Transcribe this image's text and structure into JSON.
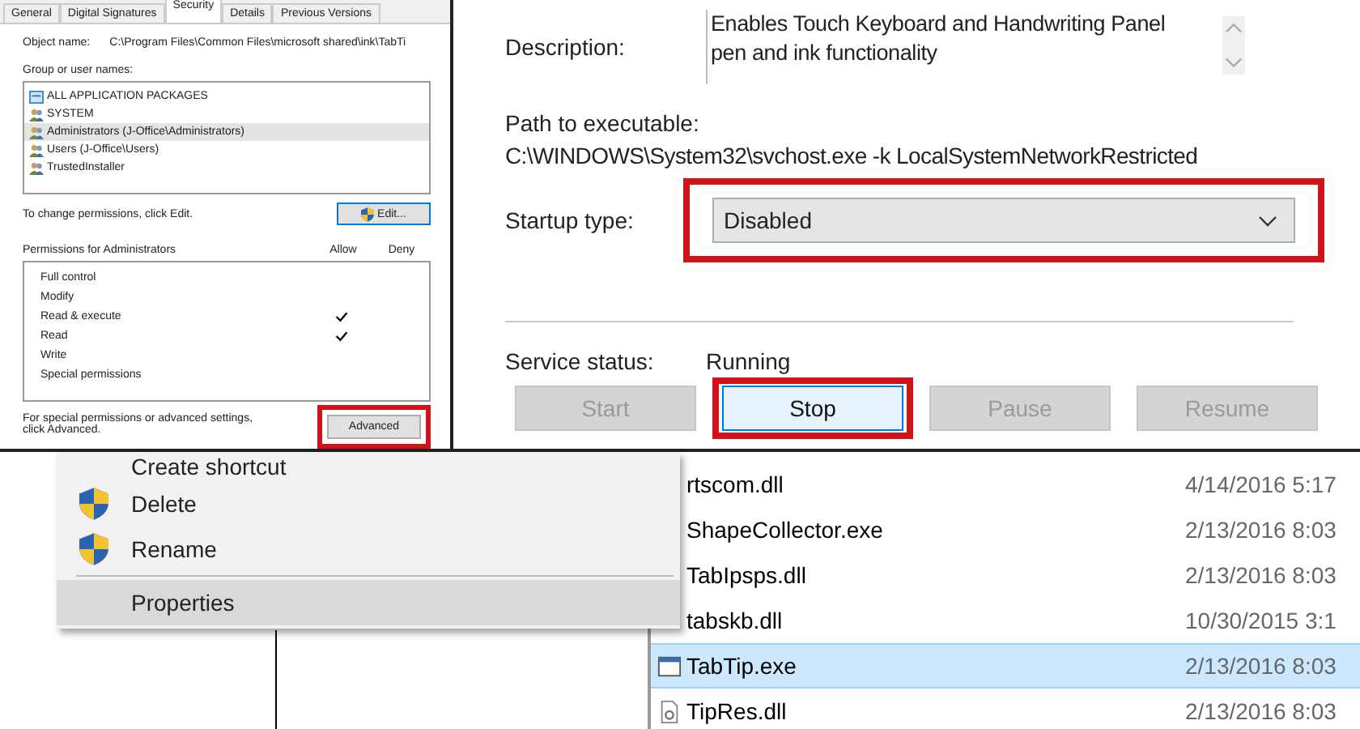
{
  "security": {
    "tabs": [
      {
        "label": "General",
        "selected": false
      },
      {
        "label": "Digital Signatures",
        "selected": false
      },
      {
        "label": "Security",
        "selected": true
      },
      {
        "label": "Details",
        "selected": false
      },
      {
        "label": "Previous Versions",
        "selected": false
      }
    ],
    "object_name_label": "Object name:",
    "object_name": "C:\\Program Files\\Common Files\\microsoft shared\\ink\\TabTi",
    "group_label": "Group or user names:",
    "groups": [
      {
        "name": "ALL APPLICATION PACKAGES",
        "kind": "package",
        "selected": false
      },
      {
        "name": "SYSTEM",
        "kind": "users",
        "selected": false
      },
      {
        "name": "Administrators (J-Office\\Administrators)",
        "kind": "users",
        "selected": true
      },
      {
        "name": "Users (J-Office\\Users)",
        "kind": "users",
        "selected": false
      },
      {
        "name": "TrustedInstaller",
        "kind": "users",
        "selected": false
      }
    ],
    "change_hint": "To change permissions, click Edit.",
    "edit_button": "Edit...",
    "permissions_label": "Permissions for Administrators",
    "allow_heading": "Allow",
    "deny_heading": "Deny",
    "permissions": [
      {
        "name": "Full control",
        "allow": false,
        "deny": false
      },
      {
        "name": "Modify",
        "allow": false,
        "deny": false
      },
      {
        "name": "Read & execute",
        "allow": true,
        "deny": false
      },
      {
        "name": "Read",
        "allow": true,
        "deny": false
      },
      {
        "name": "Write",
        "allow": false,
        "deny": false
      },
      {
        "name": "Special permissions",
        "allow": false,
        "deny": false
      }
    ],
    "advanced_hint": "For special permissions or advanced settings, click Advanced.",
    "advanced_button": "Advanced",
    "advanced_highlighted": true
  },
  "service": {
    "description_label": "Description:",
    "description": "Enables Touch Keyboard and Handwriting Panel pen and ink functionality",
    "path_label": "Path to executable:",
    "path": "C:\\WINDOWS\\System32\\svchost.exe -k LocalSystemNetworkRestricted",
    "startup_label": "Startup type:",
    "startup_value": "Disabled",
    "startup_highlighted": true,
    "status_label": "Service status:",
    "status": "Running",
    "buttons": [
      {
        "label": "Start",
        "disabled": true,
        "highlighted": false
      },
      {
        "label": "Stop",
        "disabled": false,
        "highlighted": true
      },
      {
        "label": "Pause",
        "disabled": true,
        "highlighted": false
      },
      {
        "label": "Resume",
        "disabled": true,
        "highlighted": false
      }
    ]
  },
  "context_menu": {
    "items": [
      {
        "label": "Create shortcut",
        "shield": false,
        "separator_before": false,
        "selected": false
      },
      {
        "label": "Delete",
        "shield": true,
        "separator_before": false,
        "selected": false
      },
      {
        "label": "Rename",
        "shield": true,
        "separator_before": false,
        "selected": false
      },
      {
        "label": "Properties",
        "shield": false,
        "separator_before": true,
        "selected": true
      }
    ]
  },
  "files": [
    {
      "name": "rtscom.dll",
      "date": "4/14/2016 5:17",
      "kind": "covered",
      "selected": false
    },
    {
      "name": "ShapeCollector.exe",
      "date": "2/13/2016 8:03",
      "kind": "covered",
      "selected": false
    },
    {
      "name": "TabIpsps.dll",
      "date": "2/13/2016 8:03",
      "kind": "covered",
      "selected": false
    },
    {
      "name": "tabskb.dll",
      "date": "10/30/2015 3:1",
      "kind": "covered",
      "selected": false
    },
    {
      "name": "TabTip.exe",
      "date": "2/13/2016 8:03",
      "kind": "exe",
      "selected": true
    },
    {
      "name": "TipRes.dll",
      "date": "2/13/2016 8:03",
      "kind": "dll",
      "selected": false
    }
  ]
}
